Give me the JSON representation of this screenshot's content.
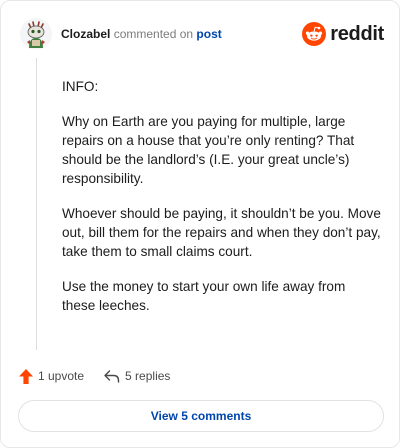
{
  "header": {
    "username": "Clozabel",
    "action_text": "commented on",
    "target_link": "post",
    "brand_name": "reddit"
  },
  "comment": {
    "paragraphs": [
      "INFO:",
      "Why on Earth are you paying for multiple, large repairs on a house that you’re only renting? That should be the landlord’s (I.E. your great uncle’s) responsibility.",
      "Whoever should be paying, it shouldn’t be you. Move out, bill them for the repairs and when they don’t pay, take them to small claims court.",
      "Use the money to start your own life away from these leeches."
    ]
  },
  "actions": {
    "upvote_label": "1 upvote",
    "replies_label": "5 replies"
  },
  "footer": {
    "view_comments_label": "View 5 comments"
  },
  "colors": {
    "brand_orange": "#ff4500",
    "link_blue": "#0045ac",
    "upvote_orange": "#ff4500"
  },
  "icons": {
    "avatar": "snoo-avatar",
    "brand": "reddit-logo-icon",
    "upvote": "upvote-arrow-icon",
    "reply": "reply-arrow-icon"
  }
}
